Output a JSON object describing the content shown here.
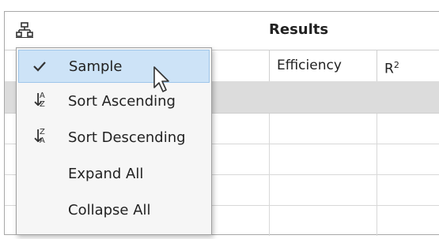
{
  "header": {
    "title": "Results",
    "tree_icon": "hierarchy-icon"
  },
  "columns": [
    {
      "label": "Efficiency"
    },
    {
      "label": "R",
      "sup": "2"
    }
  ],
  "menu": {
    "items": [
      {
        "label": "Sample",
        "icon": "checkmark-icon",
        "checked": true
      },
      {
        "label": "Sort Ascending",
        "icon": "sort-ascending-icon",
        "letters": [
          "A",
          "Z"
        ]
      },
      {
        "label": "Sort Descending",
        "icon": "sort-descending-icon",
        "letters": [
          "Z",
          "A"
        ]
      },
      {
        "label": "Expand All",
        "icon": ""
      },
      {
        "label": "Collapse All",
        "icon": ""
      }
    ]
  },
  "colors": {
    "selected_bg": "#cde3f7",
    "row_grey": "#dcdcdc",
    "accent_red": "#c0392b"
  }
}
